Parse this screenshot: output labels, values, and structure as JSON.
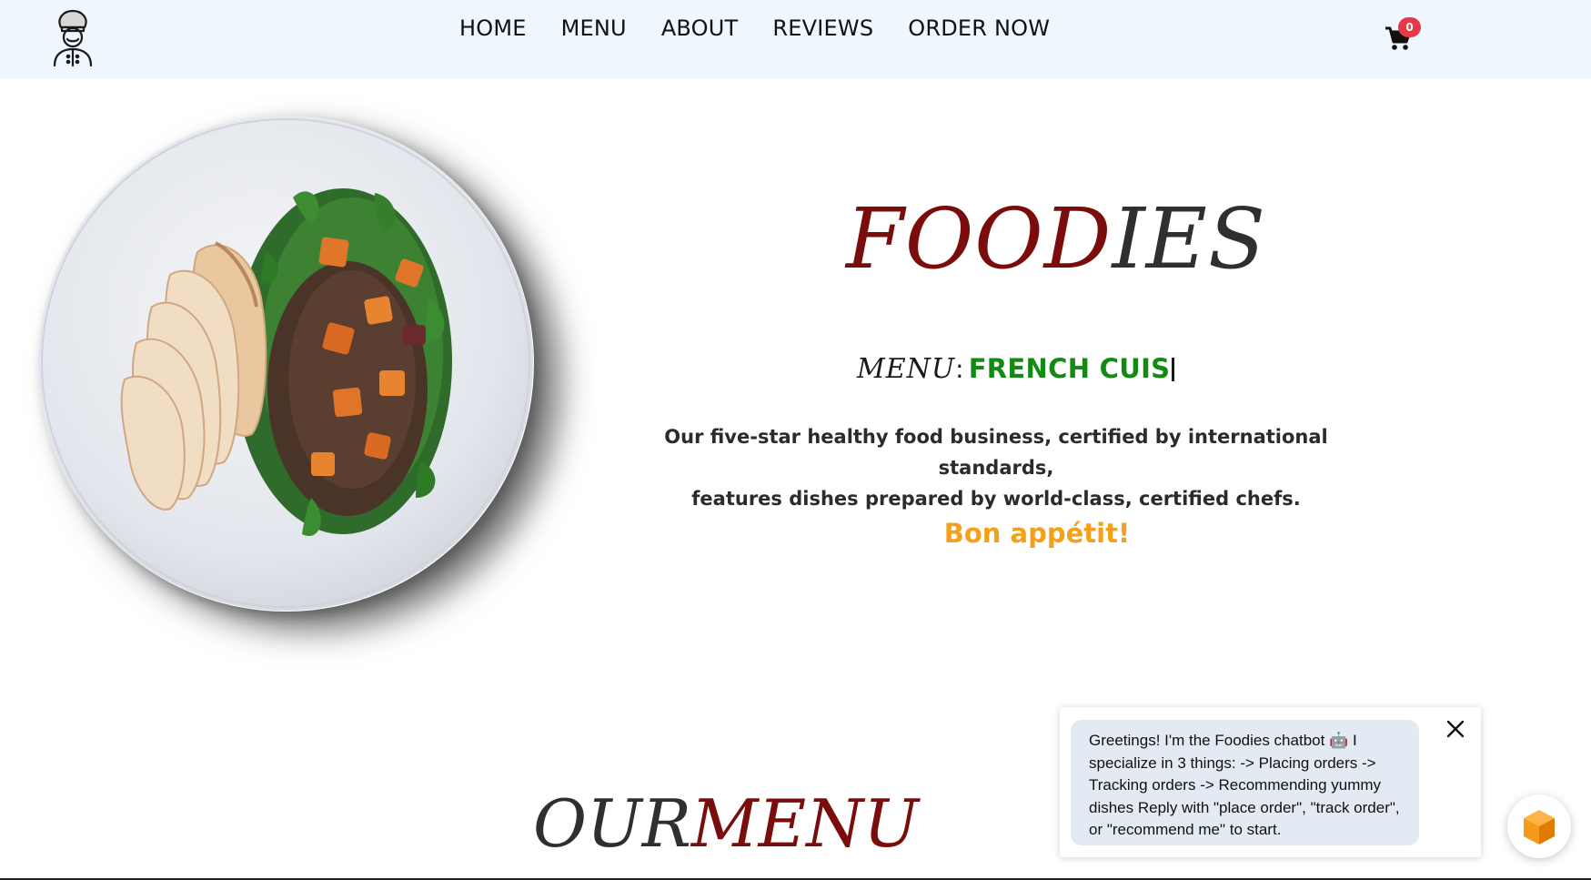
{
  "nav": {
    "logo_icon": "chef-avatar-icon",
    "links": [
      "HOME",
      "MENU",
      "ABOUT",
      "REVIEWS",
      "ORDER NOW"
    ],
    "cart_icon": "cart-icon",
    "cart_count": "0"
  },
  "hero": {
    "image_icon": "salad-plate-image",
    "brand_accent": "FOOD",
    "brand_rest": "IES",
    "menu_label": "MENU",
    "menu_colon": ":",
    "menu_typed": "FRENCH CUIS",
    "tagline_line1": "Our five-star healthy food business, certified by international standards,",
    "tagline_line2": "features dishes prepared by world-class, certified chefs.",
    "greeting": "Bon appétit!"
  },
  "section": {
    "title_dark": "OUR",
    "title_red": "MENU"
  },
  "chatbot": {
    "message": "Greetings! I'm the Foodies chatbot 🤖 I specialize in 3 things: -> Placing orders -> Tracking orders -> Recommending yummy dishes Reply with \"place order\", \"track order\", or \"recommend me\" to start.",
    "close_icon": "close-icon",
    "launcher_icon": "cube-icon"
  },
  "colors": {
    "navbar_bg": "#eef6fe",
    "brand_red": "#7a0c0c",
    "menu_green": "#138a13",
    "bon_orange": "#f4a018",
    "badge_red": "#e63946",
    "bubble_bg": "#e4eaf3"
  }
}
